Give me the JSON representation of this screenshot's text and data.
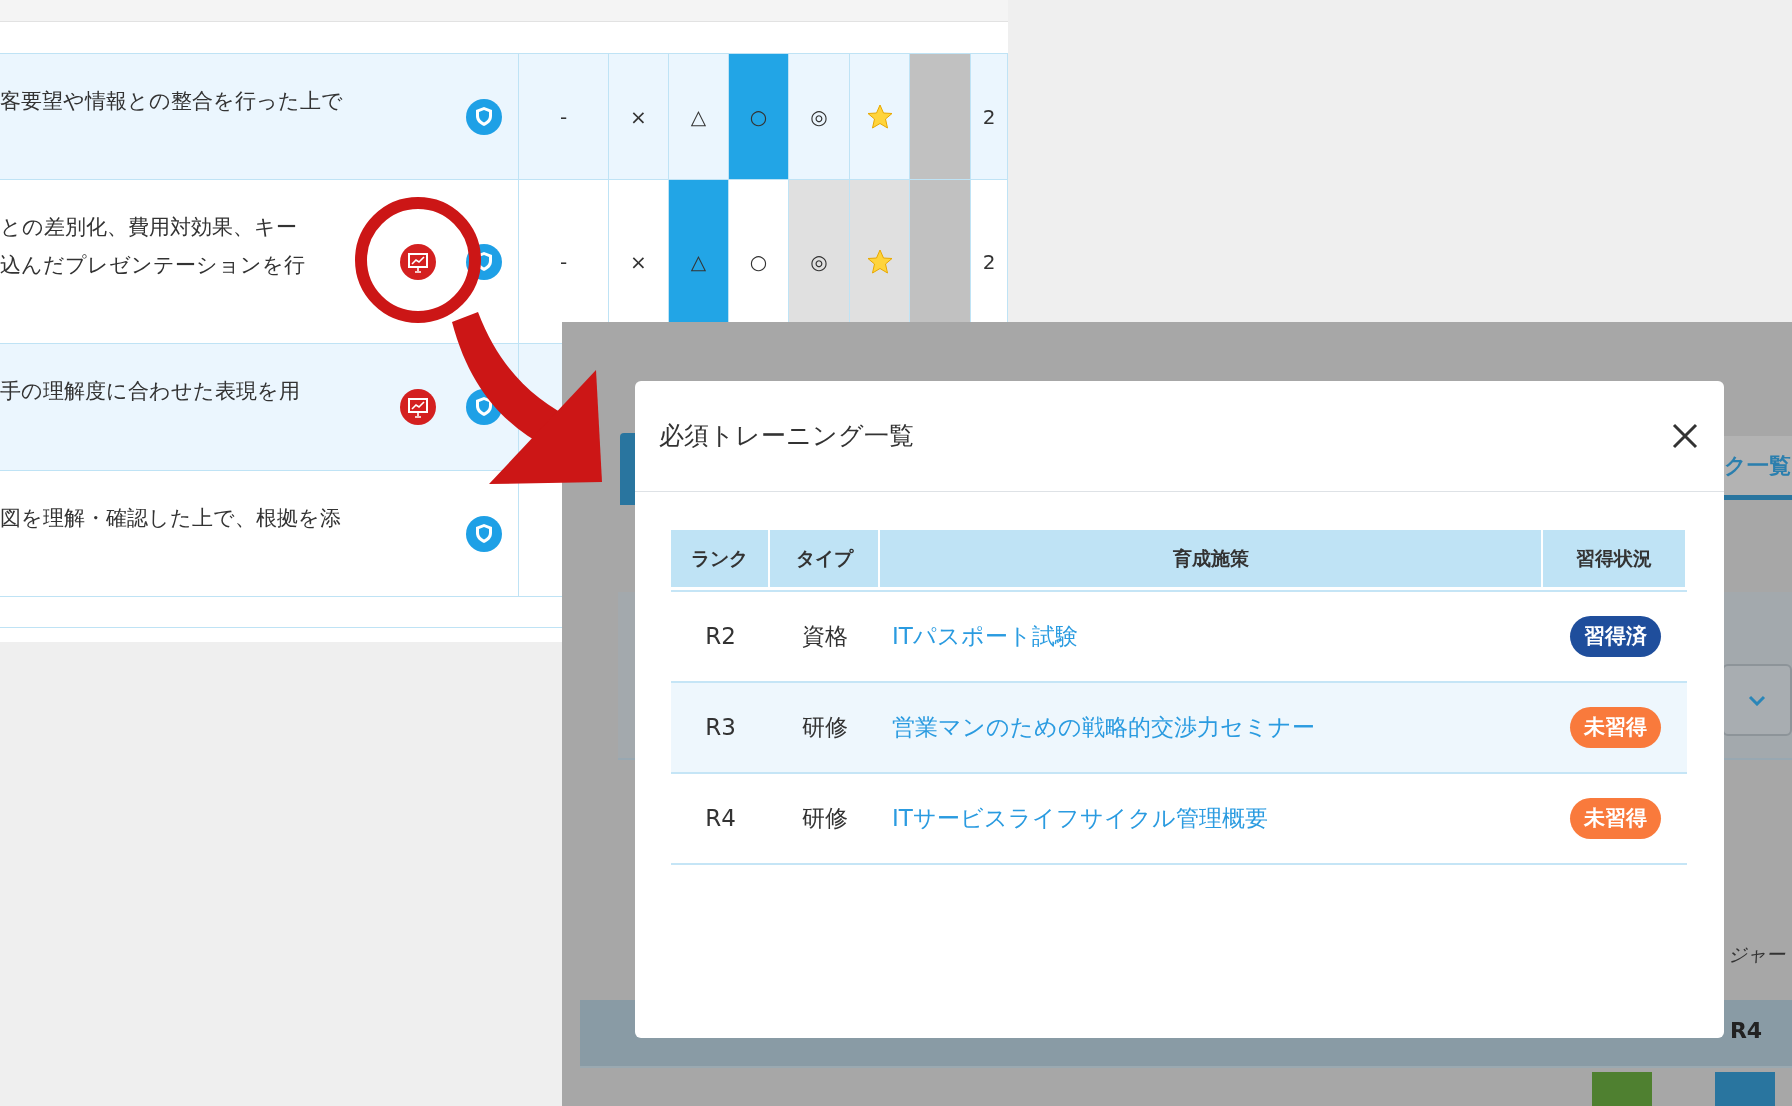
{
  "background_table": {
    "rows": [
      {
        "lines": [
          "客要望や情報との整合を行った上で"
        ],
        "shaded": true,
        "icons": [
          {
            "kind": "shield"
          }
        ],
        "cells": [
          {
            "kind": "text",
            "text": "-"
          },
          {
            "kind": "text",
            "text": "×"
          },
          {
            "kind": "text",
            "text": "△"
          },
          {
            "kind": "text",
            "text": "○",
            "color": "#22a5e6"
          },
          {
            "kind": "text",
            "text": "◎"
          },
          {
            "kind": "star"
          },
          {
            "kind": "blank",
            "color": "#c1c1c1"
          },
          {
            "kind": "text",
            "text": "2"
          }
        ]
      },
      {
        "lines": [
          "との差別化、費用対効果、キー",
          "込んだプレゼンテーションを行"
        ],
        "shaded": false,
        "icons": [
          {
            "kind": "presentation"
          },
          {
            "kind": "shield"
          }
        ],
        "cells": [
          {
            "kind": "text",
            "text": "-"
          },
          {
            "kind": "text",
            "text": "×"
          },
          {
            "kind": "text",
            "text": "△",
            "color": "#22a5e6"
          },
          {
            "kind": "text",
            "text": "○"
          },
          {
            "kind": "text",
            "text": "◎",
            "color": "#e0e0e0"
          },
          {
            "kind": "star",
            "color": "#e0e0e0"
          },
          {
            "kind": "blank",
            "color": "#c1c1c1"
          },
          {
            "kind": "text",
            "text": "2"
          }
        ]
      },
      {
        "lines": [
          "手の理解度に合わせた表現を用"
        ],
        "shaded": true,
        "icons": [
          {
            "kind": "presentation"
          },
          {
            "kind": "shield"
          }
        ],
        "cells": []
      },
      {
        "lines": [
          "図を理解・確認した上で、根拠を添"
        ],
        "shaded": false,
        "icons": [
          {
            "kind": "shield"
          }
        ],
        "cells": []
      }
    ]
  },
  "background_screen": {
    "tab_label": "ク一覧",
    "note": "ジャー",
    "column_label": "R4"
  },
  "modal": {
    "title": "必須トレーニング一覧",
    "columns": [
      "ランク",
      "タイプ",
      "育成施策",
      "習得状況"
    ],
    "rows": [
      {
        "rank": "R2",
        "type": "資格",
        "name": "ITパスポート試験",
        "highlighted": false,
        "status": {
          "label": "習得済",
          "acquired": true
        }
      },
      {
        "rank": "R3",
        "type": "研修",
        "name": "営業マンのための戦略的交渉力セミナー",
        "highlighted": true,
        "status": {
          "label": "未習得",
          "acquired": false
        }
      },
      {
        "rank": "R4",
        "type": "研修",
        "name": "ITサービスライフサイクル管理概要",
        "highlighted": false,
        "status": {
          "label": "未習得",
          "acquired": false
        }
      }
    ]
  }
}
